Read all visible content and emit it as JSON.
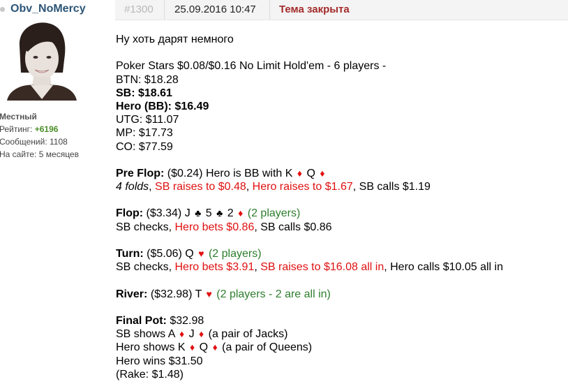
{
  "user": {
    "name": "Obv_NoMercy",
    "rank": "Местный",
    "rating_label": "Рейтинг:",
    "rating_value": "+6196",
    "posts_label": "Сообщений:",
    "posts_value": "1108",
    "online_label": "На сайте:",
    "online_value": "5 месяцев",
    "avatar_icon": "user-avatar-photo"
  },
  "post": {
    "number": "#1300",
    "date": "25.09.2016 10:47",
    "status": "Тема закрыта",
    "intro": "Ну хоть дарят немного"
  },
  "hand": {
    "game": "Poker Stars $0.08/$0.16 No Limit Hold'em - 6 players -",
    "players": [
      {
        "text": "BTN: $18.28",
        "bold": false
      },
      {
        "text": "SB: $18.61",
        "bold": true
      },
      {
        "text": "Hero (BB): $16.49",
        "bold": true
      },
      {
        "text": "UTG: $11.07",
        "bold": false
      },
      {
        "text": "MP: $17.73",
        "bold": false
      },
      {
        "text": "CO: $77.59",
        "bold": false
      }
    ],
    "preflop": {
      "label": "Pre Flop:",
      "pot": "($0.24) Hero is BB with K",
      "card2": "Q",
      "folds": "4 folds",
      "sep": ", ",
      "sb_raise": "SB raises to $0.48",
      "hero_raise": "Hero raises to $1.67",
      "sb_call": ", SB calls $1.19"
    },
    "flop": {
      "label": "Flop:",
      "pot": "($3.34) J",
      "c2": "5",
      "c3": "2",
      "players": "(2 players)",
      "sb_check": "SB checks, ",
      "hero_bet": "Hero bets $0.86",
      "sb_call": ", SB calls $0.86"
    },
    "turn": {
      "label": "Turn:",
      "pot": "($5.06) Q",
      "players": "(2 players)",
      "sb_check": "SB checks, ",
      "hero_bet": "Hero bets $3.91",
      "sep": ", ",
      "sb_raise": "SB raises to $16.08 all in",
      "hero_call": ", Hero calls $10.05 all in"
    },
    "river": {
      "label": "River:",
      "pot": "($32.98) T",
      "players": "(2 players - 2 are all in)"
    },
    "summary": {
      "label": "Final Pot:",
      "pot": "$32.98",
      "sb_shows": "SB shows A",
      "sb_card2": "J",
      "sb_desc": "(a pair of Jacks)",
      "hero_shows": "Hero shows K",
      "hero_card2": "Q",
      "hero_desc": "(a pair of Queens)",
      "hero_wins": "Hero wins $31.50",
      "rake": "(Rake: $1.48)"
    },
    "suits": {
      "diamond": "♦",
      "club": "♣",
      "heart": "♥"
    }
  }
}
